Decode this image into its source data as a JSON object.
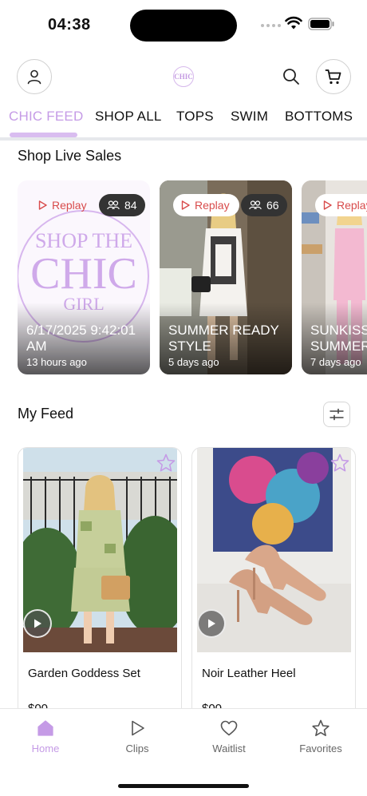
{
  "status_bar": {
    "time": "04:38"
  },
  "header": {
    "logo_text": "CHIC",
    "icons": {
      "profile": "person-icon",
      "search": "search-icon",
      "cart": "cart-icon"
    }
  },
  "tabs": [
    {
      "label": "CHIC FEED",
      "active": true
    },
    {
      "label": "SHOP ALL",
      "active": false
    },
    {
      "label": "TOPS",
      "active": false
    },
    {
      "label": "SWIM",
      "active": false
    },
    {
      "label": "BOTTOMS",
      "active": false
    }
  ],
  "live_sales": {
    "title": "Shop Live Sales",
    "cards": [
      {
        "replay_label": "Replay",
        "viewers": "84",
        "title": "6/17/2025 9:42:01 AM",
        "subtitle": "13 hours ago",
        "image_text": "SHOP THE CHIC GIRL"
      },
      {
        "replay_label": "Replay",
        "viewers": "66",
        "title": "SUMMER READY STYLE",
        "subtitle": "5 days ago"
      },
      {
        "replay_label": "Replay",
        "title": "SUNKISS SUMMER",
        "subtitle": "7 days ago"
      }
    ]
  },
  "feed": {
    "title": "My Feed",
    "products": [
      {
        "name": "Garden Goddess Set",
        "price": "$00"
      },
      {
        "name": "Noir Leather Heel",
        "price": "$00"
      }
    ]
  },
  "bottom_nav": [
    {
      "label": "Home",
      "icon": "home-icon",
      "active": true
    },
    {
      "label": "Clips",
      "icon": "play-icon",
      "active": false
    },
    {
      "label": "Waitlist",
      "icon": "heart-icon",
      "active": false
    },
    {
      "label": "Favorites",
      "icon": "star-icon",
      "active": false
    }
  ],
  "colors": {
    "accent": "#c59be6",
    "replay": "#d84b4b",
    "divider": "#e6e8ec"
  }
}
